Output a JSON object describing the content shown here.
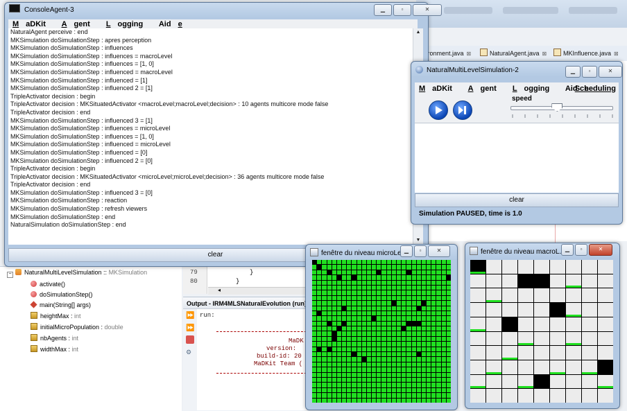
{
  "ide": {
    "editor_tabs": [
      {
        "label": "vironment.java"
      },
      {
        "label": "NaturalAgent.java"
      },
      {
        "label": "MKInfluence.java"
      }
    ],
    "navigator": [
      {
        "label": "NaturalMultiLevelSimulation :: ",
        "extra": "MKSimulation",
        "icon": "class-icon"
      },
      {
        "label": "activate()",
        "icon": "method-icon"
      },
      {
        "label": "doSimulationStep()",
        "icon": "method-icon"
      },
      {
        "label": "main(String[] args)",
        "icon": "static-method-icon"
      },
      {
        "label": "heightMax : ",
        "extra": "int",
        "icon": "field-icon"
      },
      {
        "label": "initialMicroPopulation : ",
        "extra": "double",
        "icon": "field-icon"
      },
      {
        "label": "nbAgents : ",
        "extra": "int",
        "icon": "field-icon"
      },
      {
        "label": "widthMax : ",
        "extra": "int",
        "icon": "field-icon"
      }
    ],
    "code_lines": [
      {
        "num": "79",
        "text": "}"
      },
      {
        "num": "80",
        "text": "}"
      }
    ],
    "output_title": "Output - IRM4MLSNaturalEvolution (run)",
    "output_lines": [
      "run:",
      "MaDK",
      "version:",
      "build-id: 20",
      "MaDKit Team ("
    ]
  },
  "console": {
    "title": "ConsoleAgent-3",
    "menu": [
      {
        "label": "MaDKit",
        "u": "M"
      },
      {
        "label": "Agent",
        "u": "A"
      },
      {
        "label": "Logging",
        "u": "L"
      },
      {
        "label": "Aide",
        "u": "e"
      }
    ],
    "lines": [
      "NaturalAgent perceive : end",
      "MKSimulation doSimulationStep : apres perception",
      "MKSimulation doSimulationStep : influences",
      "MKSimulation doSimulationStep : influences = macroLevel",
      "MKSimulation doSimulationStep : influences = [1, 0]",
      "MKSimulation doSimulationStep : influenced = macroLevel",
      "MKSimulation doSimulationStep : influenced = [1]",
      "MKSimulation doSimulationStep : influenced 2 = [1]",
      "TripleActivator decision : begin",
      "TripleActivator decision : MKSituatedActivator <macroLevel;macroLevel;decision> : 10 agents multicore mode false",
      "TripleActivator decision : end",
      "MKSimulation doSimulationStep : influenced 3 = [1]",
      "MKSimulation doSimulationStep : influences = microLevel",
      "MKSimulation doSimulationStep : influences = [1, 0]",
      "MKSimulation doSimulationStep : influenced = microLevel",
      "MKSimulation doSimulationStep : influenced = [0]",
      "MKSimulation doSimulationStep : influenced 2 = [0]",
      "TripleActivator decision : begin",
      "TripleActivator decision : MKSituatedActivator <microLevel;microLevel;decision> : 36 agents multicore mode false",
      "TripleActivator decision : end",
      "MKSimulation doSimulationStep : influenced 3 = [0]",
      "MKSimulation doSimulationStep : reaction",
      "MKSimulation doSimulationStep : refresh viewers",
      "MKSimulation doSimulationStep : end",
      "NaturalSimulation doSimulationStep : end"
    ],
    "clear_label": "clear"
  },
  "simulation": {
    "title": "NaturalMultiLevelSimulation-2",
    "menu": [
      {
        "label": "MaDKit",
        "u": "M"
      },
      {
        "label": "Agent",
        "u": "A"
      },
      {
        "label": "Logging",
        "u": "L"
      },
      {
        "label": "Aide",
        "u": "e"
      }
    ],
    "scheduling_label": "Scheduling",
    "speed_label": "speed",
    "speed_level": 0.45,
    "clear_label": "clear",
    "status": "Simulation PAUSED, time is 1.0"
  },
  "micro_window": {
    "title": "fenêtre du niveau microLe...",
    "rows": 28,
    "cols": 28,
    "agents": [
      [
        0,
        0
      ],
      [
        1,
        1
      ],
      [
        2,
        3
      ],
      [
        3,
        5
      ],
      [
        3,
        8
      ],
      [
        2,
        13
      ],
      [
        2,
        19
      ],
      [
        3,
        27
      ],
      [
        8,
        16
      ],
      [
        9,
        6
      ],
      [
        8,
        22
      ],
      [
        9,
        21
      ],
      [
        10,
        1
      ],
      [
        11,
        12
      ],
      [
        12,
        3
      ],
      [
        12,
        6
      ],
      [
        12,
        19
      ],
      [
        12,
        20
      ],
      [
        12,
        21
      ],
      [
        13,
        5
      ],
      [
        13,
        18
      ],
      [
        14,
        4
      ],
      [
        15,
        4
      ],
      [
        17,
        1
      ],
      [
        17,
        3
      ],
      [
        18,
        8
      ],
      [
        18,
        21
      ],
      [
        19,
        10
      ]
    ]
  },
  "macro_window": {
    "title": "fenêtre du niveau macroL...",
    "rows": 10,
    "cols": 9,
    "agents": [
      [
        0,
        0
      ],
      [
        1,
        3
      ],
      [
        1,
        4
      ],
      [
        3,
        5
      ],
      [
        4,
        2
      ],
      [
        7,
        8
      ],
      [
        8,
        4
      ]
    ],
    "green_marks": [
      [
        0,
        0
      ],
      [
        1,
        6
      ],
      [
        2,
        1
      ],
      [
        3,
        6
      ],
      [
        4,
        0
      ],
      [
        5,
        3
      ],
      [
        5,
        6
      ],
      [
        6,
        2
      ],
      [
        7,
        1
      ],
      [
        7,
        5
      ],
      [
        7,
        7
      ],
      [
        8,
        0
      ],
      [
        8,
        3
      ],
      [
        8,
        8
      ]
    ]
  }
}
